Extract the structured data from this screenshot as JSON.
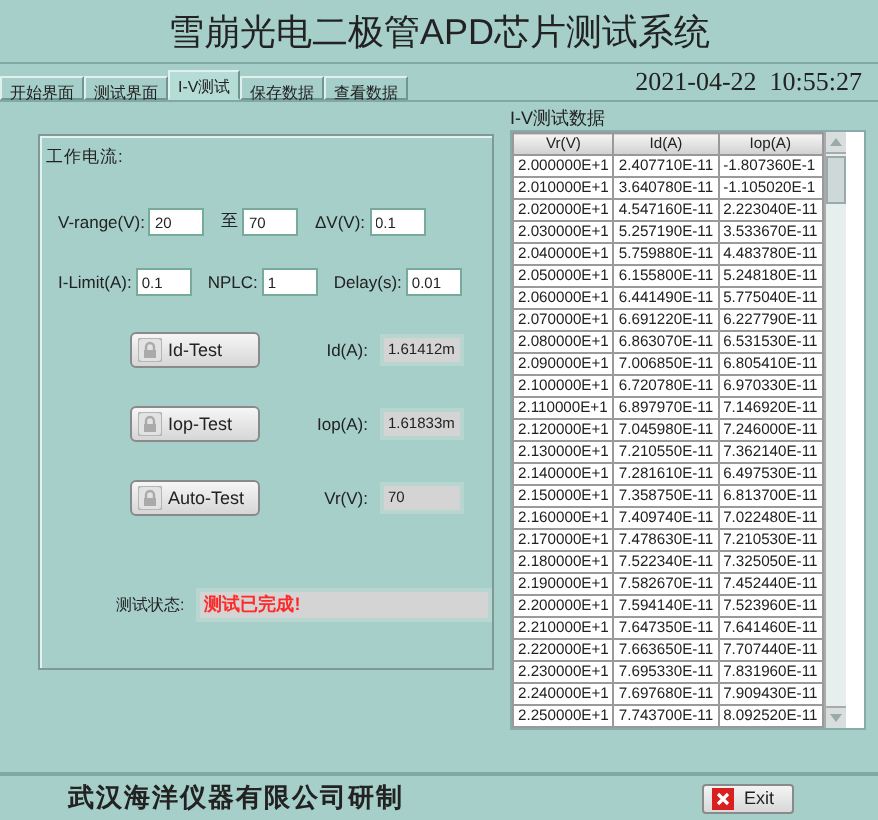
{
  "window": {
    "title": "雪崩光电二极管APD芯片测试系统"
  },
  "tabs": [
    {
      "label": "开始界面",
      "selected": false
    },
    {
      "label": "测试界面",
      "selected": false
    },
    {
      "label": "I-V测试",
      "selected": true
    },
    {
      "label": "保存数据",
      "selected": false
    },
    {
      "label": "查看数据",
      "selected": false
    }
  ],
  "datetime": "2021-04-22  10:55:27",
  "settings": {
    "group_title": "工作电流:",
    "field_rows": [
      [
        {
          "label": "V-range(V):",
          "value": "20"
        },
        {
          "label": "至",
          "value": "70"
        },
        {
          "label": "ΔV(V):",
          "value": "0.1"
        }
      ],
      [
        {
          "label": "I-Limit(A):",
          "value": "0.1"
        },
        {
          "label": "NPLC:",
          "value": "1"
        },
        {
          "label": "Delay(s):",
          "value": "0.01"
        }
      ]
    ],
    "tests": [
      {
        "button": "Id-Test",
        "label": "Id(A):",
        "reading": "1.61412m"
      },
      {
        "button": "Iop-Test",
        "label": "Iop(A):",
        "reading": "1.61833m"
      },
      {
        "button": "Auto-Test",
        "label": "Vr(V):",
        "reading": "70"
      }
    ],
    "status": {
      "label": "测试状态:",
      "value": "测试已完成!"
    }
  },
  "table": {
    "title": "I-V测试数据",
    "columns": [
      "Vr(V)",
      "Id(A)",
      "Iop(A)"
    ],
    "rows": [
      [
        "2.000000E+1",
        "2.407710E-11",
        "-1.807360E-1"
      ],
      [
        "2.010000E+1",
        "3.640780E-11",
        "-1.105020E-1"
      ],
      [
        "2.020000E+1",
        "4.547160E-11",
        "2.223040E-11"
      ],
      [
        "2.030000E+1",
        "5.257190E-11",
        "3.533670E-11"
      ],
      [
        "2.040000E+1",
        "5.759880E-11",
        "4.483780E-11"
      ],
      [
        "2.050000E+1",
        "6.155800E-11",
        "5.248180E-11"
      ],
      [
        "2.060000E+1",
        "6.441490E-11",
        "5.775040E-11"
      ],
      [
        "2.070000E+1",
        "6.691220E-11",
        "6.227790E-11"
      ],
      [
        "2.080000E+1",
        "6.863070E-11",
        "6.531530E-11"
      ],
      [
        "2.090000E+1",
        "7.006850E-11",
        "6.805410E-11"
      ],
      [
        "2.100000E+1",
        "6.720780E-11",
        "6.970330E-11"
      ],
      [
        "2.110000E+1",
        "6.897970E-11",
        "7.146920E-11"
      ],
      [
        "2.120000E+1",
        "7.045980E-11",
        "7.246000E-11"
      ],
      [
        "2.130000E+1",
        "7.210550E-11",
        "7.362140E-11"
      ],
      [
        "2.140000E+1",
        "7.281610E-11",
        "6.497530E-11"
      ],
      [
        "2.150000E+1",
        "7.358750E-11",
        "6.813700E-11"
      ],
      [
        "2.160000E+1",
        "7.409740E-11",
        "7.022480E-11"
      ],
      [
        "2.170000E+1",
        "7.478630E-11",
        "7.210530E-11"
      ],
      [
        "2.180000E+1",
        "7.522340E-11",
        "7.325050E-11"
      ],
      [
        "2.190000E+1",
        "7.582670E-11",
        "7.452440E-11"
      ],
      [
        "2.200000E+1",
        "7.594140E-11",
        "7.523960E-11"
      ],
      [
        "2.210000E+1",
        "7.647350E-11",
        "7.641460E-11"
      ],
      [
        "2.220000E+1",
        "7.663650E-11",
        "7.707440E-11"
      ],
      [
        "2.230000E+1",
        "7.695330E-11",
        "7.831960E-11"
      ],
      [
        "2.240000E+1",
        "7.697680E-11",
        "7.909430E-11"
      ],
      [
        "2.250000E+1",
        "7.743700E-11",
        "8.092520E-11"
      ]
    ]
  },
  "footer": {
    "company": "武汉海洋仪器有限公司研制",
    "exit_button": "Exit"
  }
}
